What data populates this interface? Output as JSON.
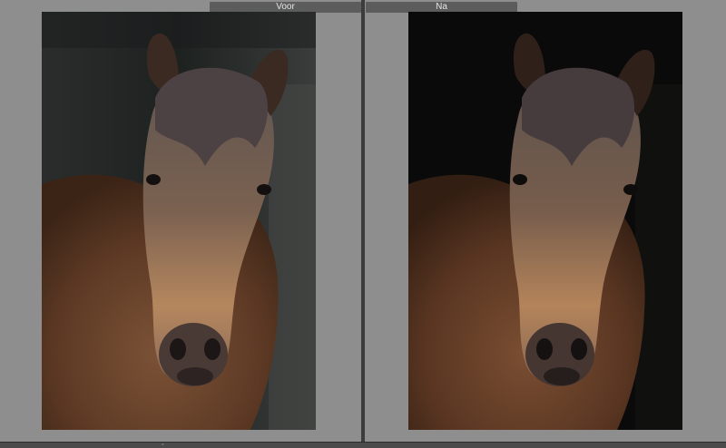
{
  "compare": {
    "before_label": "Voor",
    "after_label": "Na"
  },
  "colors": {
    "pane_background": "#8e8e8e",
    "header_background": "#5c5c5c",
    "header_text": "#e6e6e6",
    "divider": "#3c3c3c"
  },
  "images": {
    "before_icon": "horse-photo-icon",
    "after_icon": "horse-photo-icon"
  }
}
